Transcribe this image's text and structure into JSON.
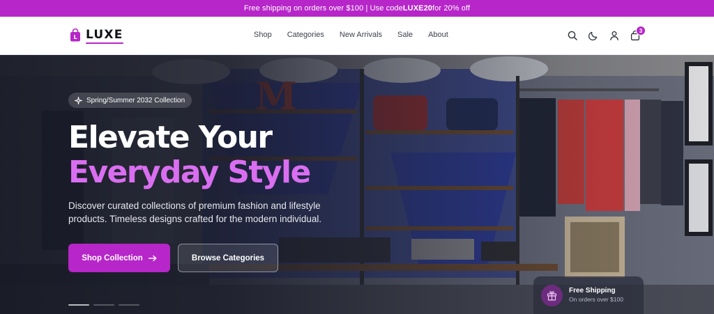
{
  "announcement": {
    "prefix": "Free shipping on orders over $100 | Use code ",
    "code": "LUXE20",
    "suffix": " for 20% off"
  },
  "brand": {
    "name": "LUXE",
    "accent": "#b626c8",
    "highlight": "#d96ef0"
  },
  "nav": [
    "Shop",
    "Categories",
    "New Arrivals",
    "Sale",
    "About"
  ],
  "header_icons": [
    "search-icon",
    "moon-icon",
    "user-icon",
    "bag-icon"
  ],
  "cart": {
    "count": "3"
  },
  "hero": {
    "badge": "Spring/Summer 2032 Collection",
    "badge_icon": "sparkle-icon",
    "title_line1": "Elevate Your",
    "title_line2": "Everyday Style",
    "description": "Discover curated collections of premium fashion and lifestyle products. Timeless designs crafted for the modern individual.",
    "primary_cta": "Shop Collection",
    "secondary_cta": "Browse Categories"
  },
  "shipping_card": {
    "title": "Free Shipping",
    "subtitle": "On orders over $100",
    "icon": "gift-icon"
  }
}
